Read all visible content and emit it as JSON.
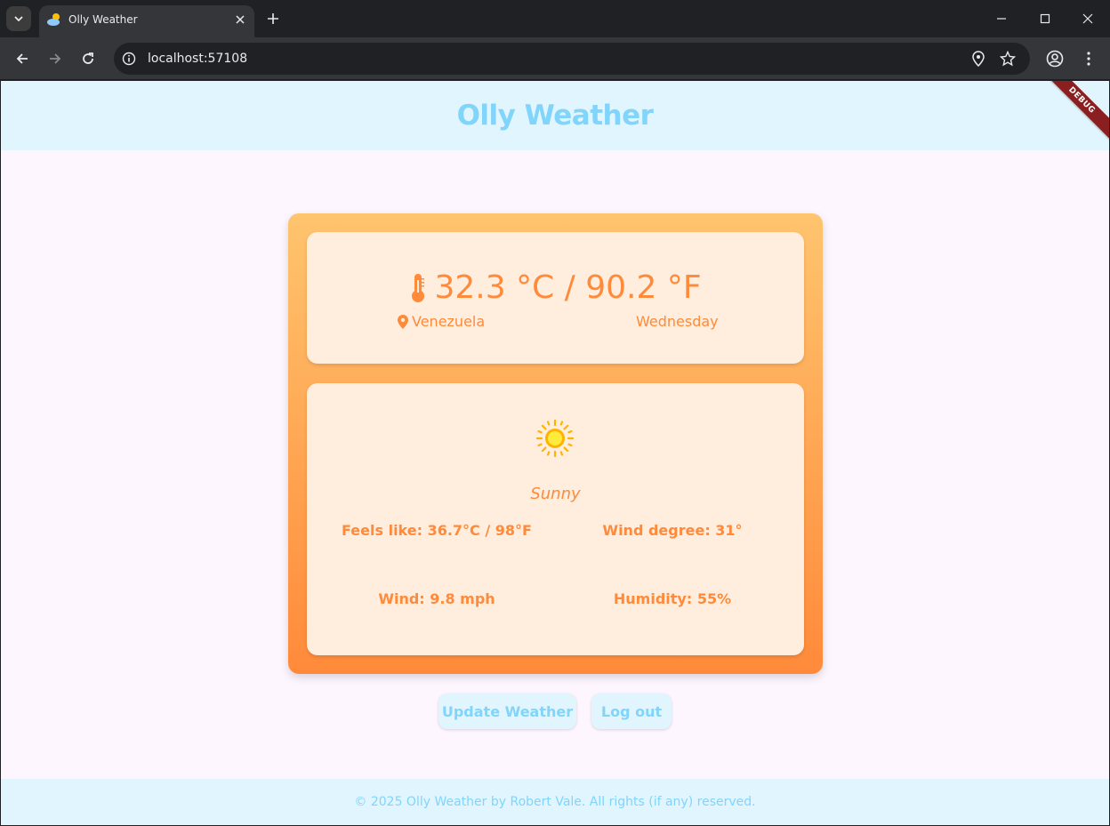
{
  "browser": {
    "tab_title": "Olly Weather",
    "url": "localhost:57108"
  },
  "app": {
    "title": "Olly Weather",
    "debug_banner": "DEBUG"
  },
  "weather": {
    "temperature": "32.3 °C / 90.2 °F",
    "location": "Venezuela",
    "day": "Wednesday",
    "condition": "Sunny",
    "feels_like": "Feels like: 36.7°C / 98°F",
    "wind_degree": "Wind degree: 31°",
    "wind": "Wind: 9.8 mph",
    "humidity": "Humidity: 55%"
  },
  "actions": {
    "update_label": "Update Weather",
    "logout_label": "Log out"
  },
  "footer": {
    "text": "© 2025 Olly Weather by Robert Vale. All rights (if any) reserved."
  },
  "colors": {
    "accent_blue": "#81d4fa",
    "appbar_bg": "#e1f5fe",
    "card_gradient_top": "#ffc46e",
    "card_gradient_bottom": "#ff8a3a",
    "inner_card_bg": "#ffeddd",
    "text_orange": "#ff8a3a"
  },
  "icons": [
    "tab-search-icon",
    "weather-favicon-icon",
    "close-icon",
    "plus-icon",
    "minimize-icon",
    "maximize-icon",
    "back-icon",
    "forward-icon",
    "reload-icon",
    "site-info-icon",
    "location-icon",
    "star-icon",
    "profile-icon",
    "menu-icon",
    "thermometer-icon",
    "map-pin-icon",
    "sun-icon"
  ]
}
